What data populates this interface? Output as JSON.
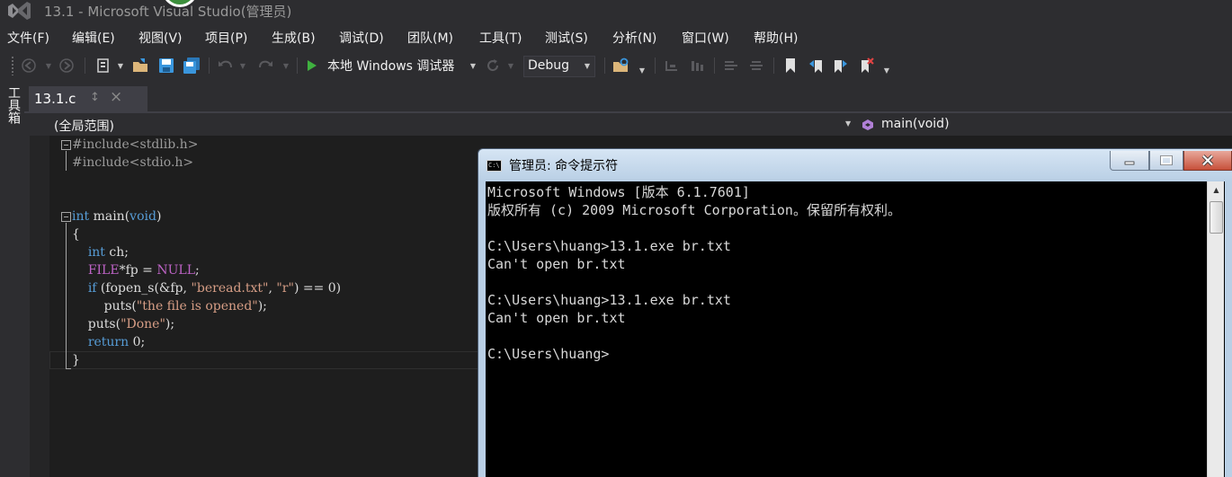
{
  "window": {
    "title": "13.1 - Microsoft Visual Studio(管理员)"
  },
  "menu": [
    {
      "label": "文件(F)"
    },
    {
      "label": "编辑(E)"
    },
    {
      "label": "视图(V)"
    },
    {
      "label": "项目(P)"
    },
    {
      "label": "生成(B)"
    },
    {
      "label": "调试(D)"
    },
    {
      "label": "团队(M)"
    },
    {
      "label": "工具(T)"
    },
    {
      "label": "测试(S)"
    },
    {
      "label": "分析(N)"
    },
    {
      "label": "窗口(W)"
    },
    {
      "label": "帮助(H)"
    }
  ],
  "toolbar": {
    "run_label": "本地 Windows 调试器",
    "config_value": "Debug"
  },
  "toolbox_label": "工具箱",
  "tab": {
    "label": "13.1.c",
    "pin_glyph": "↕",
    "close_glyph": "×"
  },
  "nav": {
    "scope": "(全局范围)",
    "function": "main(void)"
  },
  "code": {
    "lines": [
      "#include<stdlib.h>",
      "#include<stdio.h>",
      "",
      "",
      "int main(void)",
      "{",
      "    int ch;",
      "    FILE*fp = NULL;",
      "    if (fopen_s(&fp, \"beread.txt\", \"r\") == 0)",
      "        puts(\"the file is opened\");",
      "    puts(\"Done\");",
      "    return 0;",
      "}"
    ]
  },
  "console": {
    "title": "管理员: 命令提示符",
    "icon_text": "C:\\",
    "lines": [
      "Microsoft Windows [版本 6.1.7601]",
      "版权所有 (c) 2009 Microsoft Corporation。保留所有权利。",
      "",
      "C:\\Users\\huang>13.1.exe br.txt",
      "Can't open br.txt",
      "",
      "C:\\Users\\huang>13.1.exe br.txt",
      "Can't open br.txt",
      "",
      "C:\\Users\\huang>"
    ]
  },
  "colors": {
    "ide_background": "#2d2d30",
    "editor_background": "#1e1e1e",
    "keyword": "#569cd6",
    "string": "#d69d85",
    "macro": "#bd63c5",
    "run_green": "#3fb13f",
    "console_frame": "#b9cfe5"
  }
}
